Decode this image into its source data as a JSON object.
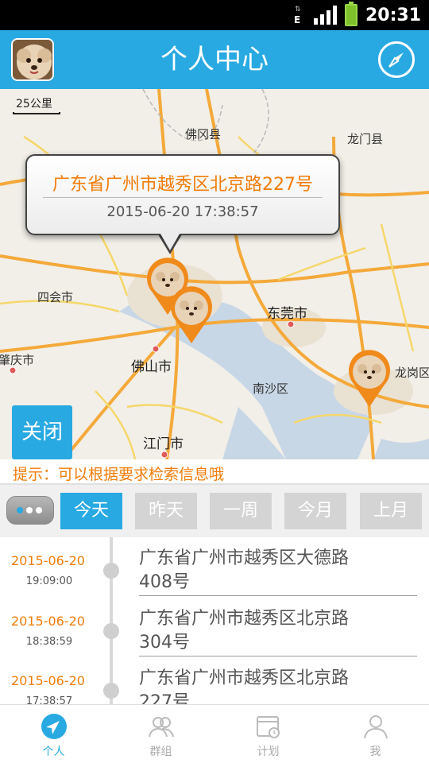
{
  "status_bar": {
    "network_type": "E",
    "time": "20:31",
    "icons": [
      "network-e-icon",
      "signal-icon",
      "battery-icon"
    ]
  },
  "header": {
    "title": "个人中心",
    "avatar": "dog-avatar",
    "right_icon": "compass-icon"
  },
  "map": {
    "scale": "25公里",
    "labels": [
      "佛冈县",
      "龙门县",
      "四会市",
      "东莞市",
      "肇庆市",
      "佛山市",
      "南沙区",
      "龙岗区",
      "江门市"
    ],
    "callout": {
      "address": "广东省广州市越秀区北京路227号",
      "time": "2015-06-20 17:38:57"
    },
    "close_label": "关闭",
    "pin_icon": "dog-location-pin"
  },
  "hint": "提示：可以根据要求检索信息哦",
  "filters": {
    "more_icon": "more-dots-icon",
    "tabs": [
      "今天",
      "昨天",
      "一周",
      "今月",
      "上月"
    ],
    "active_index": 0
  },
  "history": [
    {
      "date": "2015-06-20",
      "time": "19:09:00",
      "address": "广东省广州市越秀区大德路408号"
    },
    {
      "date": "2015-06-20",
      "time": "18:38:59",
      "address": "广东省广州市越秀区北京路304号"
    },
    {
      "date": "2015-06-20",
      "time": "17:38:57",
      "address": "广东省广州市越秀区北京路227号"
    }
  ],
  "bottom_nav": [
    {
      "label": "个人",
      "icon": "location-arrow-icon",
      "active": true
    },
    {
      "label": "群组",
      "icon": "group-icon",
      "active": false
    },
    {
      "label": "计划",
      "icon": "plan-icon",
      "active": false
    },
    {
      "label": "我",
      "icon": "person-icon",
      "active": false
    }
  ],
  "colors": {
    "accent": "#28a9e2",
    "highlight": "#f07d0a"
  }
}
